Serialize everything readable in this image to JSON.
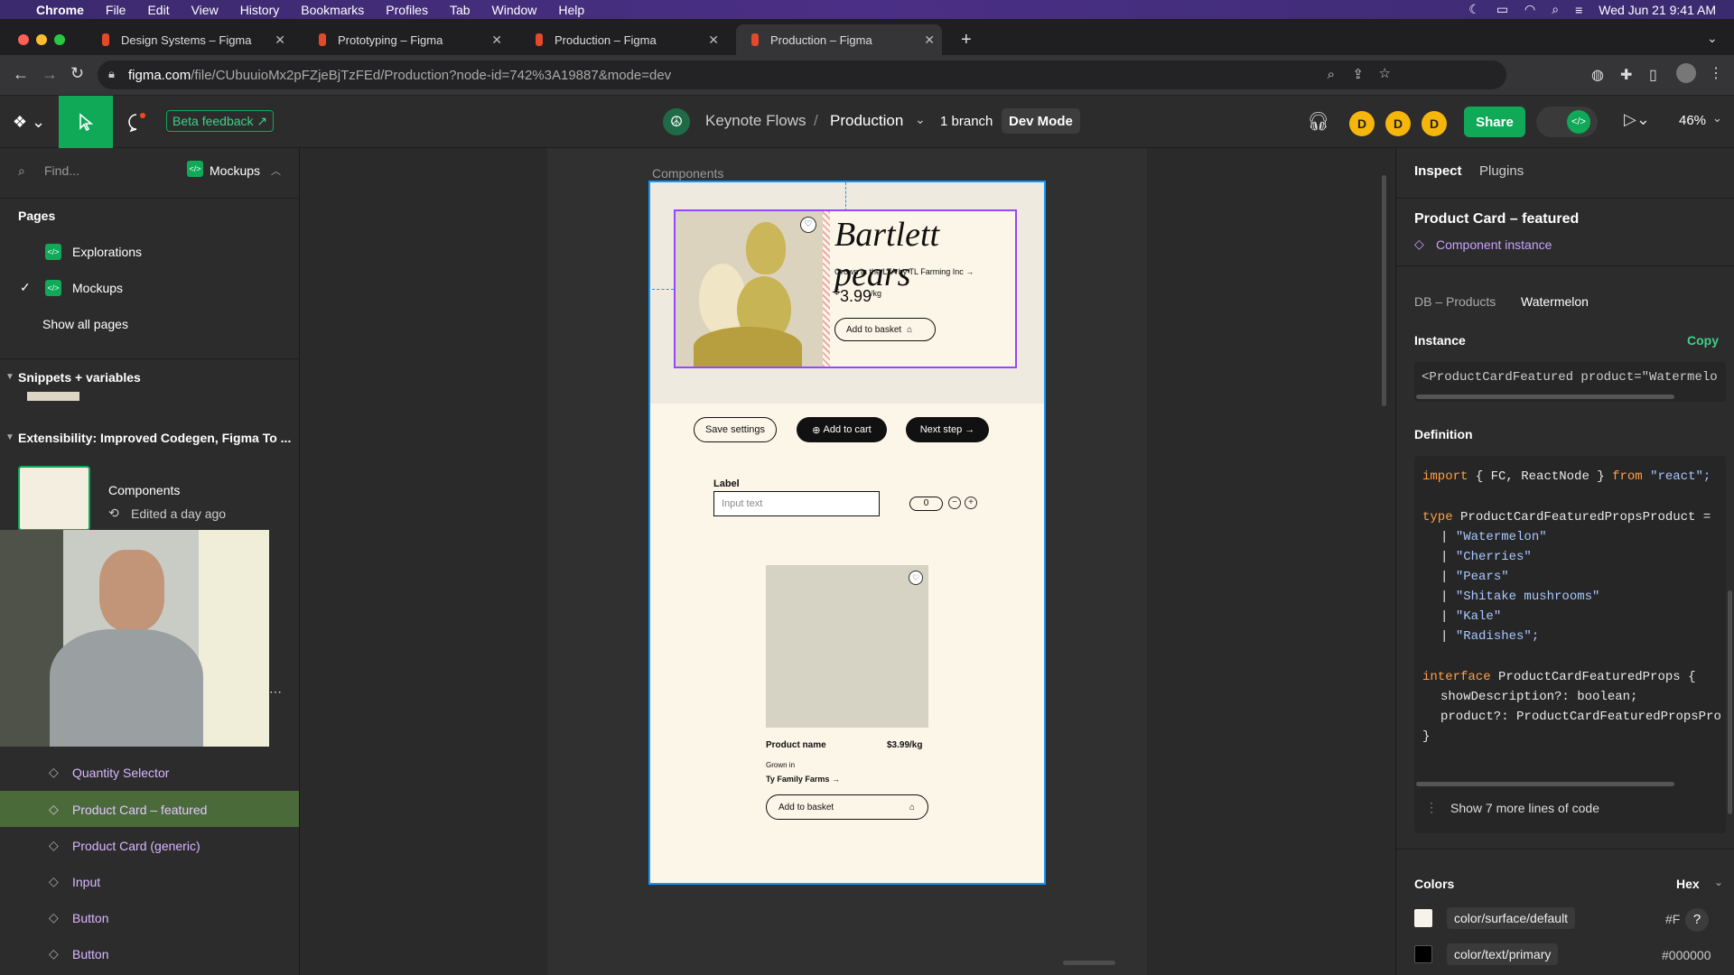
{
  "mac_menu": {
    "app": "Chrome",
    "items": [
      "File",
      "Edit",
      "View",
      "History",
      "Bookmarks",
      "Profiles",
      "Tab",
      "Window",
      "Help"
    ],
    "clock": "Wed Jun 21  9:41 AM"
  },
  "tabs": [
    {
      "title": "Design Systems – Figma"
    },
    {
      "title": "Prototyping – Figma"
    },
    {
      "title": "Production – Figma"
    },
    {
      "title": "Production – Figma"
    }
  ],
  "url": {
    "domain": "figma.com",
    "path": "/file/CUbuuioMx2pFZjeBjTzFEd/Production?node-id=742%3A19887&mode=dev"
  },
  "toolbar": {
    "beta_feedback": "Beta feedback",
    "file_project": "Keynote Flows",
    "file_name": "Production",
    "branch": "1 branch",
    "dev_mode": "Dev Mode",
    "avatars": [
      "D",
      "D",
      "D"
    ],
    "share": "Share",
    "zoom": "46%"
  },
  "left": {
    "search_placeholder": "Find...",
    "page_selector": "Mockups",
    "pages_heading": "Pages",
    "pages": [
      "Explorations",
      "Mockups"
    ],
    "show_all": "Show all pages",
    "snippets": "Snippets + variables",
    "extensibility": "Extensibility: Improved Codegen, Figma To ...",
    "components_title": "Components",
    "components_edited": "Edited a day ago",
    "layers": [
      "Quantity Selector",
      "Product Card – featured",
      "Product Card (generic)",
      "Input",
      "Button",
      "Button"
    ]
  },
  "canvas": {
    "frame_label": "Components",
    "featured": {
      "title": "Bartlett pears",
      "grown": "Grown in the LTA by TL Farming Inc →",
      "currency": "$",
      "price": "3.99",
      "unit": "/kg",
      "add_basket": "Add to basket"
    },
    "buttons": {
      "save": "Save settings",
      "add_cart": "Add to cart",
      "next": "Next step"
    },
    "input": {
      "label": "Label",
      "placeholder": "Input text",
      "qty": "0"
    },
    "generic": {
      "name": "Product name",
      "price": "$3.99/kg",
      "grown_in": "Grown in",
      "farm": "Ty Family Farms →",
      "add_basket": "Add to basket"
    }
  },
  "right": {
    "tabs": [
      "Inspect",
      "Plugins"
    ],
    "title": "Product Card – featured",
    "instance_type": "Component instance",
    "db": "DB – Products",
    "db_value": "Watermelon",
    "instance_heading": "Instance",
    "copy": "Copy",
    "instance_code": "<ProductCardFeatured product=\"Watermelo",
    "definition_heading": "Definition",
    "code": {
      "import_line": [
        "import",
        "{ FC, ReactNode }",
        "from",
        "\"react\";"
      ],
      "type_line": [
        "type",
        "ProductCardFeaturedPropsProduct ="
      ],
      "options": [
        "\"Watermelon\"",
        "\"Cherries\"",
        "\"Pears\"",
        "\"Shitake mushrooms\"",
        "\"Kale\"",
        "\"Radishes\";"
      ],
      "interface_line": [
        "interface",
        "ProductCardFeaturedProps {"
      ],
      "prop1": "showDescription?: boolean;",
      "prop2": "product?: ProductCardFeaturedPropsPro",
      "close": "}"
    },
    "show_more": "Show 7 more lines of code",
    "colors_heading": "Colors",
    "color_format": "Hex",
    "colors": [
      {
        "name": "color/surface/default",
        "hex": "#F",
        "swatch": "#f7f3ea"
      },
      {
        "name": "color/text/primary",
        "hex": "#000000",
        "swatch": "#000000"
      }
    ]
  },
  "colors": {
    "figma_green": "#0fa958",
    "frame_selection": "#0d99ff",
    "cream": "#fcf6e8",
    "avatar": "#f5b50a"
  }
}
